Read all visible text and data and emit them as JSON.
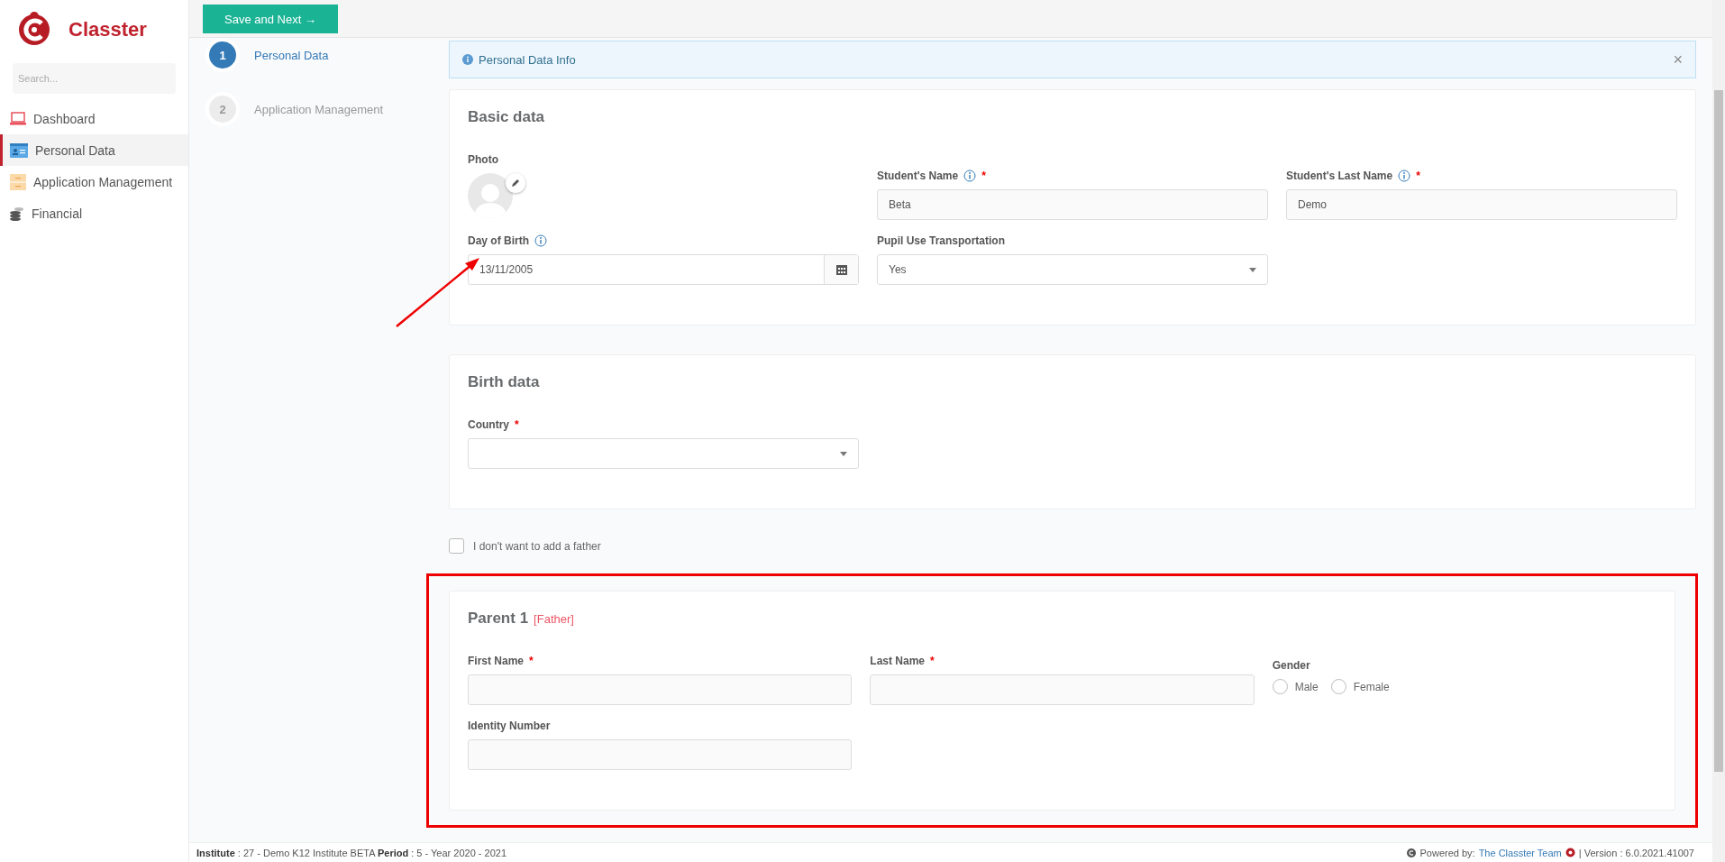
{
  "brand": {
    "name": "Classter"
  },
  "search": {
    "placeholder": "Search..."
  },
  "menu": [
    {
      "label": "Dashboard",
      "selected": false
    },
    {
      "label": "Personal Data",
      "selected": true
    },
    {
      "label": "Application Management",
      "selected": false
    },
    {
      "label": "Financial",
      "selected": false
    }
  ],
  "toolbar": {
    "save_button": "Save and Next →"
  },
  "steps": [
    {
      "number": "1",
      "label": "Personal Data",
      "selected": true
    },
    {
      "number": "2",
      "label": "Application Management",
      "selected": false
    }
  ],
  "alert": {
    "text": "Personal Data Info",
    "close": "×"
  },
  "sections": [
    {
      "title": "Basic data",
      "rows": [
        [
          {
            "kind": "photo",
            "label": "Photo"
          },
          {
            "kind": "text",
            "label": "Student's Name",
            "info": true,
            "mark": "*",
            "value": "Beta"
          },
          {
            "kind": "text",
            "label": "Student's Last Name",
            "info": true,
            "mark": "*",
            "value": "Demo"
          }
        ],
        [
          {
            "kind": "date",
            "label": "Day of Birth",
            "info": true,
            "value": "13/11/2005"
          },
          {
            "kind": "select",
            "label": "Pupil Use Transportation",
            "info": false,
            "value": "Yes"
          }
        ]
      ]
    },
    {
      "title": "Birth data",
      "rows": [
        [
          {
            "kind": "select",
            "label": "Country",
            "info": false,
            "mark": "*"
          }
        ]
      ]
    }
  ],
  "father_opt_out": {
    "label": "I don't want to add a father",
    "checked": false
  },
  "parent": {
    "title": "Parent 1",
    "tag": "[Father]",
    "rows": [
      [
        {
          "kind": "text",
          "label": "First Name",
          "mark": "*",
          "info": false
        },
        {
          "kind": "text",
          "label": "Last Name",
          "mark": "*",
          "info": false
        },
        {
          "kind": "radio",
          "label": "Gender",
          "info": false,
          "options": [
            {
              "label": "Male",
              "selected": false
            },
            {
              "label": "Female",
              "selected": false
            }
          ]
        }
      ],
      [
        {
          "kind": "text",
          "label": "Identity Number",
          "info": false
        }
      ]
    ]
  },
  "footer": {
    "left": "**Institute** : 27 - Demo K12 Institute BETA **Period** : 5 - Year 2020 - 2021",
    "powered": "Powered by:",
    "team": "The Classter Team",
    "version": "| Version : 6.0.2021.41007"
  }
}
